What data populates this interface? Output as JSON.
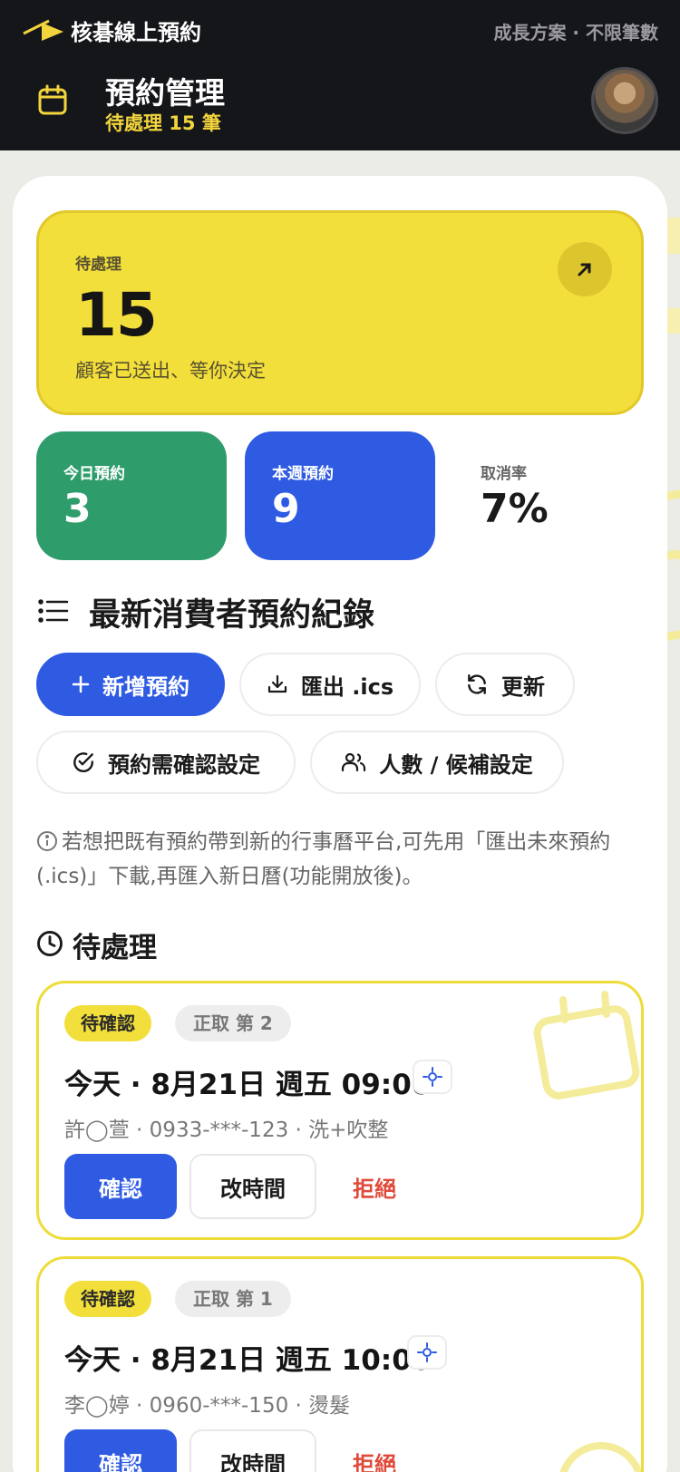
{
  "colors": {
    "topbar": "#15161a",
    "accent_yellow": "#f2df3b",
    "green": "#2f9d6b",
    "blue": "#2f5be3",
    "reject_red": "#e04a3a"
  },
  "header": {
    "brand_name": "核碁線上預約",
    "plan_label": "成長方案 · 不限筆數",
    "page_title": "預約管理",
    "page_subtitle": "待處理 15 筆",
    "title_icon": "calendar-icon",
    "avatar_icon": "avatar"
  },
  "hero": {
    "label": "待處理",
    "value": "15",
    "description": "顧客已送出、等你決定",
    "action_icon": "arrow-up-right-icon"
  },
  "stats": [
    {
      "label": "今日預約",
      "value": "3"
    },
    {
      "label": "本週預約",
      "value": "9"
    },
    {
      "label": "取消率",
      "value": "7%"
    }
  ],
  "records": {
    "title": "最新消費者預約紀錄",
    "icon": "list-icon",
    "buttons": {
      "add": "新增預約",
      "export": "匯出 .ics",
      "refresh": "更新",
      "confirm_settings": "預約需確認設定",
      "capacity_settings": "人數 / 候補設定"
    },
    "info": "若想把既有預約帶到新的行事曆平台,可先用「匯出未來預約(.ics)」下載,再匯入新日曆(功能開放後)。"
  },
  "pending": {
    "title": "待處理",
    "icon": "clock-icon",
    "bookings": [
      {
        "status": "待確認",
        "rank": "正取 第 2",
        "datetime": "今天 · 8月21日 週五 09:00",
        "detail": "許◯萱 · 0933-***-123 · 洗+吹整",
        "confirm": "確認",
        "reschedule": "改時間",
        "reject": "拒絕"
      },
      {
        "status": "待確認",
        "rank": "正取 第 1",
        "datetime": "今天 · 8月21日 週五 10:00",
        "detail": "李◯婷 · 0960-***-150 · 燙髮",
        "confirm": "確認",
        "reschedule": "改時間",
        "reject": "拒絕"
      }
    ]
  }
}
